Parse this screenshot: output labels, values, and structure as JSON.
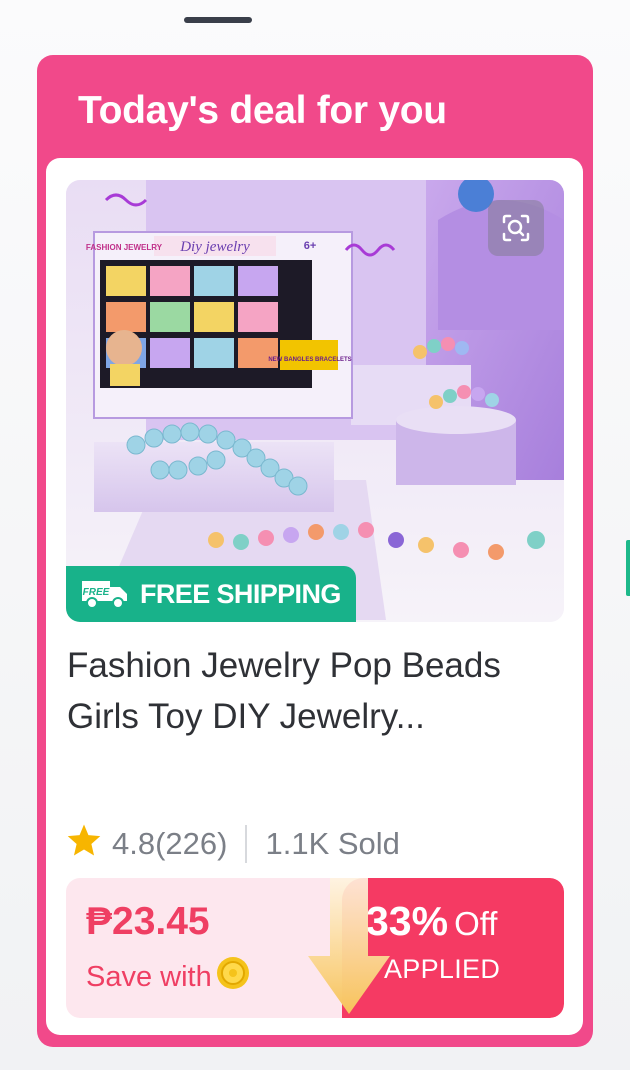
{
  "deal": {
    "title": "Today's deal for you"
  },
  "product": {
    "name": "Fashion Jewelry Pop Beads Girls Toy DIY Jewelry...",
    "image_box_text": {
      "brand": "FASHION JEWELRY",
      "label": "Diy jewelry",
      "age": "6+",
      "promo": "NEW BANGLES BRACELETS"
    },
    "shipping_badge": "FREE SHIPPING",
    "truck_text": "FREE",
    "rating": "4.8(226)",
    "sold": "1.1K Sold"
  },
  "price": {
    "value": "₱23.45",
    "save_label": "Save with",
    "discount_percent": "33%",
    "discount_off": "Off",
    "applied": "APPLIED"
  },
  "colors": {
    "brand_pink": "#f1498a",
    "shipping_green": "#18b28a",
    "price_red": "#ef3f63",
    "discount_red": "#f53a63"
  },
  "icons": {
    "visual_search": "visual-search-icon",
    "truck": "delivery-truck-icon",
    "star": "star-icon",
    "coin": "coin-icon"
  }
}
